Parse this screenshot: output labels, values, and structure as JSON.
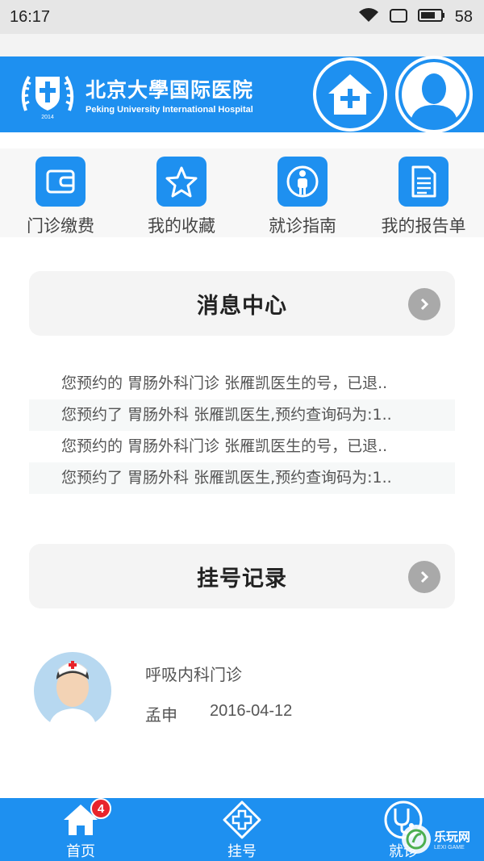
{
  "status_bar": {
    "time": "16:17",
    "battery": "58",
    "icons": [
      "wifi-icon",
      "sim-icon",
      "battery-icon"
    ]
  },
  "header": {
    "logo_cn": "北京大學国际医院",
    "logo_en": "Peking University International Hospital",
    "logo_emblem_text": "2014",
    "home_button_icon": "home-plus-icon",
    "avatar_icon": "user-avatar-icon",
    "accent_color": "#1e90f0"
  },
  "quick_menu": [
    {
      "label": "门诊缴费",
      "icon": "wallet-icon"
    },
    {
      "label": "我的收藏",
      "icon": "star-icon"
    },
    {
      "label": "就诊指南",
      "icon": "person-guide-icon"
    },
    {
      "label": "我的报告单",
      "icon": "report-icon"
    }
  ],
  "message_center": {
    "title": "消息中心",
    "messages": [
      "您预约的 胃肠外科门诊 张雁凯医生的号，已退..",
      "您预约了 胃肠外科 张雁凯医生,预约查询码为:1..",
      "您预约的 胃肠外科门诊 张雁凯医生的号，已退..",
      "您预约了 胃肠外科 张雁凯医生,预约查询码为:1.."
    ]
  },
  "registration": {
    "title": "挂号记录",
    "records": [
      {
        "department": "呼吸内科门诊",
        "name": "孟申",
        "date": "2016-04-12"
      }
    ]
  },
  "bottom_nav": {
    "items": [
      {
        "label": "首页",
        "icon": "home-icon",
        "badge": "4"
      },
      {
        "label": "挂号",
        "icon": "register-plus-icon"
      },
      {
        "label": "就诊",
        "icon": "stethoscope-icon"
      }
    ]
  },
  "watermark": {
    "cn": "乐玩网",
    "en": "LEXI GAME"
  }
}
